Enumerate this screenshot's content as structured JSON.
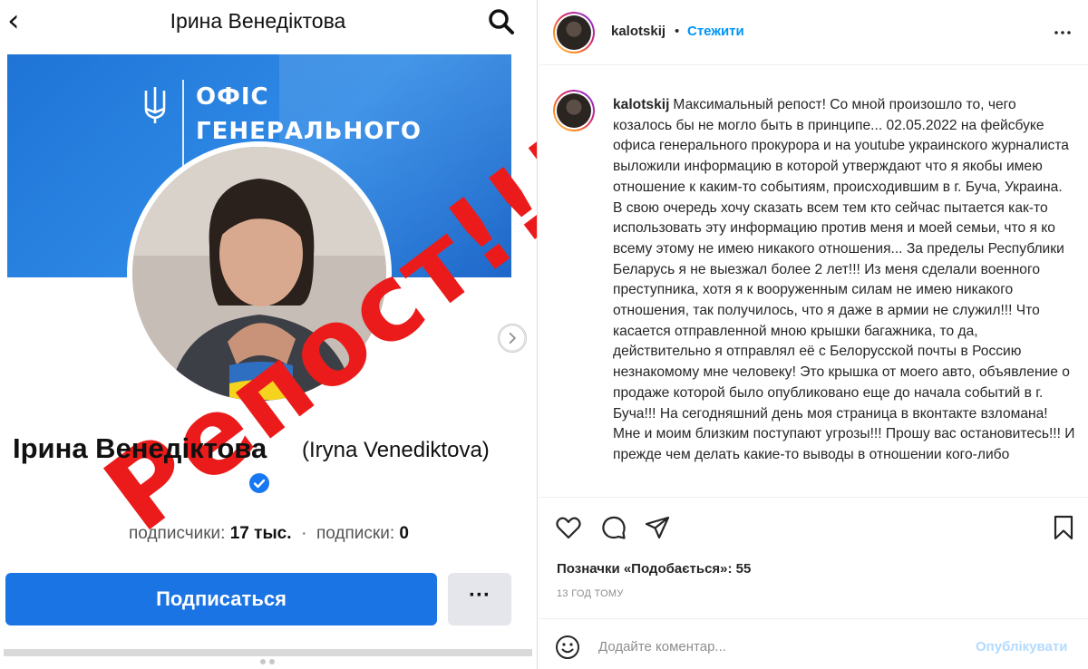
{
  "media": {
    "fb_title": "Ірина Венедіктова",
    "cover_line1": "ОФІС",
    "cover_line2": "ГЕНЕРАЛЬНОГО",
    "stamp_text": "Репост!!!",
    "profile_name": "Ірина Венедіктова",
    "profile_name_latin": "(Iryna Venediktova)",
    "followers_label": "подписчики:",
    "followers_value": "17 тыс.",
    "stats_separator": "·",
    "following_label": "подписки:",
    "following_value": "0",
    "subscribe_label": "Подписаться",
    "more_label": "···",
    "carousel_index": 1,
    "carousel_count": 3
  },
  "post": {
    "username": "kalotskij",
    "separator": "•",
    "follow_label": "Стежити",
    "caption_username": "kalotskij",
    "caption": "Максимальный репост! Со мной произошло то, чего козалось бы не могло быть в принципе... 02.05.2022 на фейсбуке офиса генерального прокурора и на youtube украинского журналиста выложили информацию в которой утверждают что я якобы имею отношение к каким-то событиям, происходившим в г. Буча, Украина. В свою очередь хочу сказать всем тем кто сейчас пытается как-то использовать эту информацию против меня и моей семьи, что я ко всему этому не имею никакого отношения... За пределы Республики Беларусь я не выезжал более 2 лет!!! Из меня сделали военного преступника, хотя я к вооруженным силам не имею никакого отношения, так получилось, что я даже в армии не служил!!! Что касается отправленной мною крышки багажника, то да, действительно я отправлял её с Белорусской почты в Россию незнакомому мне человеку! Это крышка от моего авто, объявление о продаже которой было опубликовано еще до начала событий в г. Буча!!! На сегодняшний день моя страница в вконтакте взломана! Мне и моим близким поступают угрозы!!! Прошу вас остановитесь!!! И прежде чем делать какие-то выводы в отношении кого-либо",
    "likes_text": "Позначки «Подобається»: 55",
    "time_text": "13 ГОД ТОМУ",
    "comment_placeholder": "Додайте коментар...",
    "publish_label": "Опублікувати"
  },
  "colors": {
    "accent": "#0095f6",
    "fb_blue": "#1b74e4",
    "stamp_red": "#ec1b1b",
    "publish_disabled": "#b3dbff"
  },
  "icons": [
    "back-arrow-icon",
    "search-icon",
    "trident-icon",
    "chevron-right-icon",
    "verified-icon",
    "more-icon",
    "heart-icon",
    "comment-icon",
    "share-icon",
    "bookmark-icon",
    "emoji-icon"
  ]
}
